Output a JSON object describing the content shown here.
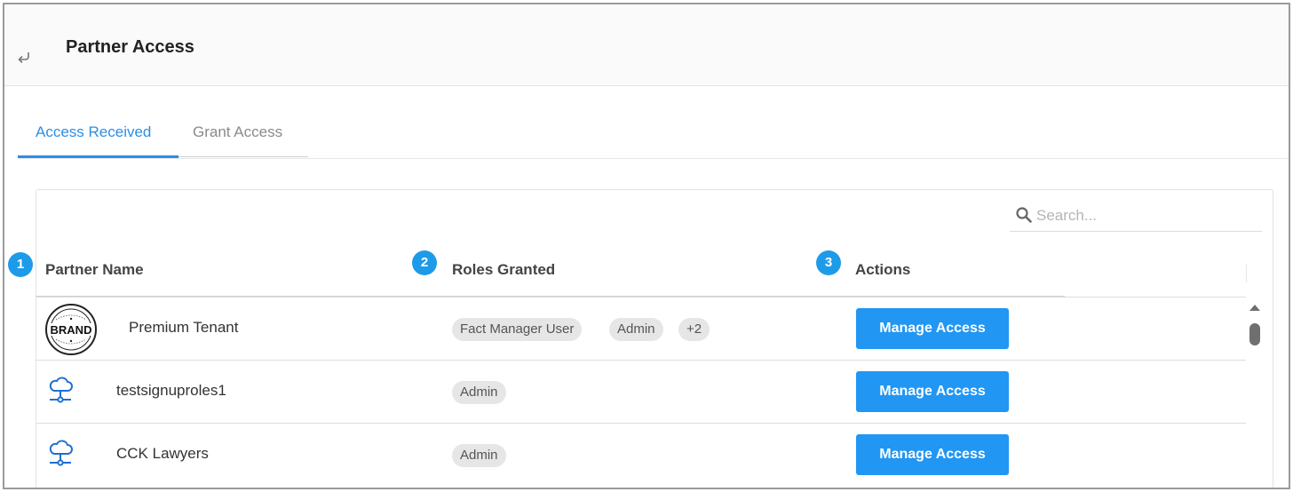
{
  "header": {
    "title": "Partner Access",
    "back_icon": "return-arrow-icon"
  },
  "tabs": [
    {
      "label": "Access Received",
      "active": true
    },
    {
      "label": "Grant Access",
      "active": false
    }
  ],
  "search": {
    "placeholder": "Search...",
    "value": "",
    "icon": "search-icon"
  },
  "table": {
    "columns": [
      {
        "label": "Partner Name",
        "marker": "1"
      },
      {
        "label": "Roles Granted",
        "marker": "2"
      },
      {
        "label": "Actions",
        "marker": "3"
      }
    ],
    "rows": [
      {
        "name": "Premium Tenant",
        "logo": "brand-logo",
        "logo_text": "BRAND",
        "roles": [
          "Fact Manager User",
          "Admin",
          "+2"
        ],
        "action": "Manage Access"
      },
      {
        "name": "testsignuproles1",
        "logo": "cloud-network-icon",
        "roles": [
          "Admin"
        ],
        "action": "Manage Access"
      },
      {
        "name": "CCK Lawyers",
        "logo": "cloud-network-icon",
        "roles": [
          "Admin"
        ],
        "action": "Manage Access"
      }
    ]
  },
  "colors": {
    "accent": "#2b8ee6",
    "button": "#2196f3",
    "badge": "#1e9be8",
    "chip": "#e6e6e6"
  }
}
